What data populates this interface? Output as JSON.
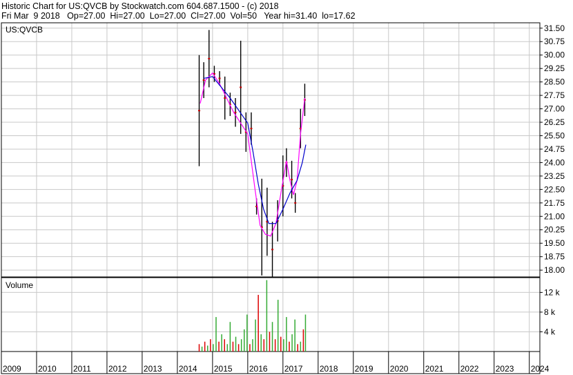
{
  "header": {
    "line1": "Historic Chart for US:QVCB by Stockwatch.com 604.687.1500 - (c) 2018",
    "line2": "Fri Mar  9 2018   Op=27.00  Hi=27.00  Lo=27.00  Cl=27.00  Vol=50   Year hi=31.40  lo=17.62"
  },
  "chart_data": {
    "type": "line",
    "symbol_label": "US:QVCB",
    "volume_label": "Volume",
    "colors": {
      "price_bars": "#000000",
      "down_marks": "#cc0000",
      "ma_short": "#ff00ff",
      "ma_long": "#0000cc",
      "volume_up": "#33aa33",
      "volume_down": "#dd0000",
      "grid": "#c8c8c8"
    },
    "price_axis": {
      "ylim": [
        17.62,
        31.8
      ],
      "ticks": [
        "31.50",
        "30.75",
        "30.00",
        "29.25",
        "28.50",
        "27.75",
        "27.00",
        "26.25",
        "25.50",
        "24.75",
        "24.00",
        "23.25",
        "22.50",
        "21.75",
        "21.00",
        "20.25",
        "19.50",
        "18.75",
        "18.00"
      ]
    },
    "volume_axis": {
      "ylim": [
        0,
        15000
      ],
      "ticks": [
        {
          "value": 12000,
          "label": "12 k"
        },
        {
          "value": 8000,
          "label": "8 k"
        },
        {
          "value": 4000,
          "label": "4 k"
        }
      ]
    },
    "x_axis": {
      "xlim": [
        2009.0,
        2024.3
      ],
      "years": [
        "2009",
        "2010",
        "2011",
        "2012",
        "2013",
        "2014",
        "2015",
        "2016",
        "2017",
        "2018",
        "2019",
        "2020",
        "2021",
        "2022",
        "2023",
        "2024"
      ]
    },
    "price_series": [
      {
        "x": 2014.62,
        "lo": 23.8,
        "hi": 30.0
      },
      {
        "x": 2014.75,
        "lo": 27.6,
        "hi": 29.6
      },
      {
        "x": 2014.9,
        "lo": 28.2,
        "hi": 31.4
      },
      {
        "x": 2015.05,
        "lo": 28.5,
        "hi": 29.4
      },
      {
        "x": 2015.2,
        "lo": 28.3,
        "hi": 29.1
      },
      {
        "x": 2015.35,
        "lo": 26.4,
        "hi": 28.8
      },
      {
        "x": 2015.5,
        "lo": 26.6,
        "hi": 27.9
      },
      {
        "x": 2015.65,
        "lo": 26.0,
        "hi": 27.6
      },
      {
        "x": 2015.8,
        "lo": 25.6,
        "hi": 30.8
      },
      {
        "x": 2015.95,
        "lo": 24.6,
        "hi": 26.8
      },
      {
        "x": 2016.1,
        "lo": 25.0,
        "hi": 26.8
      },
      {
        "x": 2016.25,
        "lo": 21.1,
        "hi": 22.0
      },
      {
        "x": 2016.4,
        "lo": 17.7,
        "hi": 23.1
      },
      {
        "x": 2016.55,
        "lo": 18.8,
        "hi": 22.6
      },
      {
        "x": 2016.7,
        "lo": 17.6,
        "hi": 20.7
      },
      {
        "x": 2016.85,
        "lo": 19.6,
        "hi": 21.9
      },
      {
        "x": 2017.0,
        "lo": 21.0,
        "hi": 24.4
      },
      {
        "x": 2017.1,
        "lo": 23.2,
        "hi": 24.8
      },
      {
        "x": 2017.25,
        "lo": 22.0,
        "hi": 24.1
      },
      {
        "x": 2017.35,
        "lo": 21.2,
        "hi": 22.3
      },
      {
        "x": 2017.5,
        "lo": 24.8,
        "hi": 27.0
      },
      {
        "x": 2017.62,
        "lo": 26.6,
        "hi": 28.4
      }
    ],
    "ma_short": [
      {
        "x": 2014.65,
        "y": 27.3
      },
      {
        "x": 2014.8,
        "y": 28.6
      },
      {
        "x": 2015.0,
        "y": 29.0
      },
      {
        "x": 2015.2,
        "y": 28.4
      },
      {
        "x": 2015.4,
        "y": 27.6
      },
      {
        "x": 2015.6,
        "y": 26.8
      },
      {
        "x": 2015.8,
        "y": 26.2
      },
      {
        "x": 2016.0,
        "y": 25.6
      },
      {
        "x": 2016.2,
        "y": 22.6
      },
      {
        "x": 2016.35,
        "y": 20.5
      },
      {
        "x": 2016.5,
        "y": 20.0
      },
      {
        "x": 2016.65,
        "y": 19.9
      },
      {
        "x": 2016.8,
        "y": 20.6
      },
      {
        "x": 2016.95,
        "y": 22.4
      },
      {
        "x": 2017.1,
        "y": 24.1
      },
      {
        "x": 2017.2,
        "y": 23.0
      },
      {
        "x": 2017.3,
        "y": 22.2
      },
      {
        "x": 2017.4,
        "y": 23.0
      },
      {
        "x": 2017.5,
        "y": 25.6
      },
      {
        "x": 2017.62,
        "y": 27.6
      }
    ],
    "ma_long": [
      {
        "x": 2014.75,
        "y": 28.7
      },
      {
        "x": 2015.0,
        "y": 28.8
      },
      {
        "x": 2015.25,
        "y": 28.2
      },
      {
        "x": 2015.5,
        "y": 27.6
      },
      {
        "x": 2015.75,
        "y": 26.9
      },
      {
        "x": 2016.0,
        "y": 26.2
      },
      {
        "x": 2016.15,
        "y": 24.6
      },
      {
        "x": 2016.3,
        "y": 22.8
      },
      {
        "x": 2016.45,
        "y": 21.4
      },
      {
        "x": 2016.6,
        "y": 20.6
      },
      {
        "x": 2016.8,
        "y": 20.6
      },
      {
        "x": 2017.0,
        "y": 21.4
      },
      {
        "x": 2017.2,
        "y": 22.3
      },
      {
        "x": 2017.4,
        "y": 23.0
      },
      {
        "x": 2017.55,
        "y": 24.0
      },
      {
        "x": 2017.65,
        "y": 25.0
      }
    ],
    "volume_series": [
      {
        "x": 2014.62,
        "v": 1500,
        "dir": "down"
      },
      {
        "x": 2014.7,
        "v": 1000,
        "dir": "up"
      },
      {
        "x": 2014.78,
        "v": 2000,
        "dir": "down"
      },
      {
        "x": 2014.86,
        "v": 1200,
        "dir": "up"
      },
      {
        "x": 2014.94,
        "v": 2500,
        "dir": "down"
      },
      {
        "x": 2015.02,
        "v": 1500,
        "dir": "up"
      },
      {
        "x": 2015.1,
        "v": 7000,
        "dir": "up"
      },
      {
        "x": 2015.18,
        "v": 2000,
        "dir": "down"
      },
      {
        "x": 2015.26,
        "v": 3500,
        "dir": "up"
      },
      {
        "x": 2015.34,
        "v": 2500,
        "dir": "down"
      },
      {
        "x": 2015.42,
        "v": 1500,
        "dir": "up"
      },
      {
        "x": 2015.5,
        "v": 6000,
        "dir": "up"
      },
      {
        "x": 2015.58,
        "v": 2000,
        "dir": "down"
      },
      {
        "x": 2015.66,
        "v": 3000,
        "dir": "up"
      },
      {
        "x": 2015.74,
        "v": 1500,
        "dir": "down"
      },
      {
        "x": 2015.82,
        "v": 2500,
        "dir": "up"
      },
      {
        "x": 2015.9,
        "v": 4500,
        "dir": "up"
      },
      {
        "x": 2015.98,
        "v": 7500,
        "dir": "up"
      },
      {
        "x": 2016.06,
        "v": 1500,
        "dir": "down"
      },
      {
        "x": 2016.14,
        "v": 2500,
        "dir": "up"
      },
      {
        "x": 2016.22,
        "v": 6500,
        "dir": "up"
      },
      {
        "x": 2016.3,
        "v": 11500,
        "dir": "down"
      },
      {
        "x": 2016.38,
        "v": 3500,
        "dir": "up"
      },
      {
        "x": 2016.46,
        "v": 2500,
        "dir": "down"
      },
      {
        "x": 2016.54,
        "v": 14500,
        "dir": "up"
      },
      {
        "x": 2016.62,
        "v": 4000,
        "dir": "down"
      },
      {
        "x": 2016.7,
        "v": 6000,
        "dir": "up"
      },
      {
        "x": 2016.78,
        "v": 2500,
        "dir": "down"
      },
      {
        "x": 2016.86,
        "v": 10500,
        "dir": "up"
      },
      {
        "x": 2016.94,
        "v": 3000,
        "dir": "down"
      },
      {
        "x": 2017.02,
        "v": 2500,
        "dir": "up"
      },
      {
        "x": 2017.1,
        "v": 7000,
        "dir": "up"
      },
      {
        "x": 2017.18,
        "v": 2000,
        "dir": "down"
      },
      {
        "x": 2017.26,
        "v": 3500,
        "dir": "up"
      },
      {
        "x": 2017.34,
        "v": 6500,
        "dir": "up"
      },
      {
        "x": 2017.42,
        "v": 1500,
        "dir": "down"
      },
      {
        "x": 2017.5,
        "v": 2000,
        "dir": "up"
      },
      {
        "x": 2017.58,
        "v": 4500,
        "dir": "down"
      },
      {
        "x": 2017.64,
        "v": 7500,
        "dir": "up"
      }
    ]
  }
}
